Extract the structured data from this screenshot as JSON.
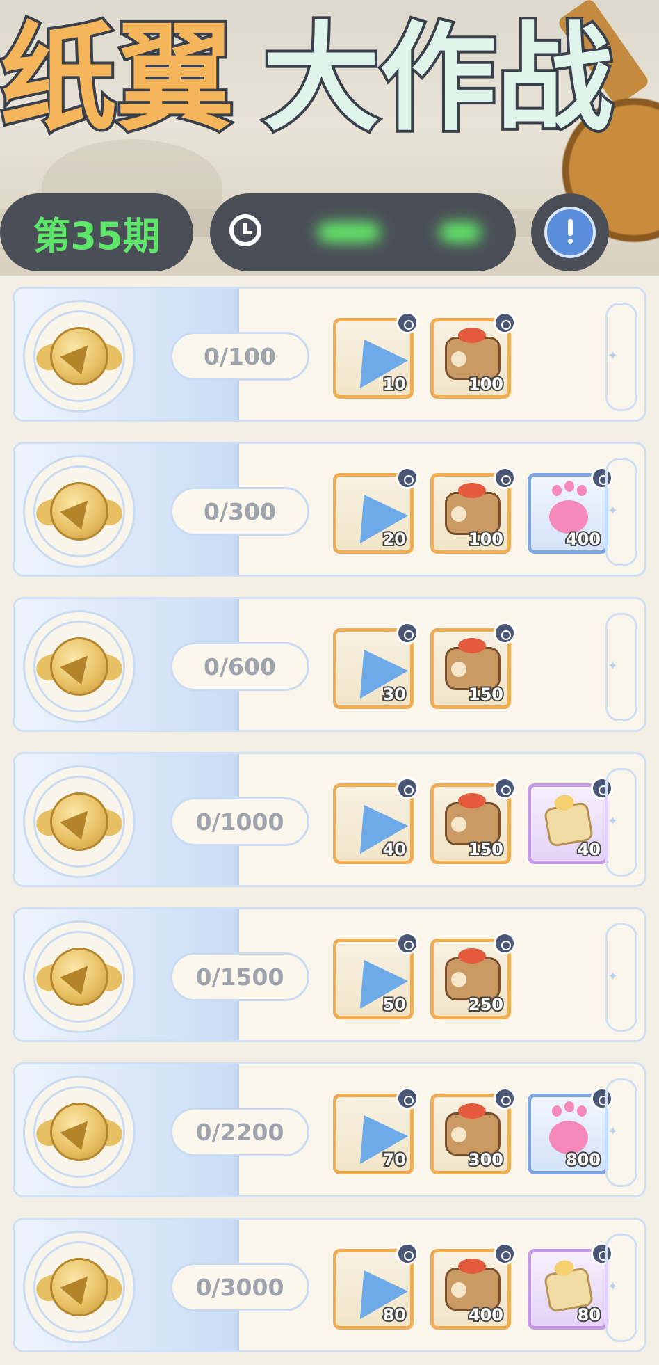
{
  "header": {
    "title_part1": "纸翼",
    "title_part2": "大作战",
    "issue_label": "第35期",
    "timer_text": "",
    "info_icon": "book-info-icon"
  },
  "colors": {
    "title_orange": "#f5b65b",
    "title_mint": "#dff4ea",
    "issue_green": "#5ee66a",
    "pill_dark": "#4a4f57",
    "row_bg": "#faf6ec",
    "accent_blue": "#c9dcf5",
    "reward_orange": "#f0ad54",
    "reward_blue": "#7fa6e4",
    "reward_purple": "#c79ae8"
  },
  "tiers": [
    {
      "progress": "0/100",
      "rewards": [
        {
          "item": "paper-plane-icon",
          "rarity": "orange",
          "count": "10"
        },
        {
          "item": "cake-roll-icon",
          "rarity": "orange",
          "count": "100"
        }
      ]
    },
    {
      "progress": "0/300",
      "rewards": [
        {
          "item": "paper-plane-icon",
          "rarity": "orange",
          "count": "20"
        },
        {
          "item": "cake-roll-icon",
          "rarity": "orange",
          "count": "100"
        },
        {
          "item": "paw-icon",
          "rarity": "blue",
          "count": "400"
        }
      ]
    },
    {
      "progress": "0/600",
      "rewards": [
        {
          "item": "paper-plane-icon",
          "rarity": "orange",
          "count": "30"
        },
        {
          "item": "cake-roll-icon",
          "rarity": "orange",
          "count": "150"
        }
      ]
    },
    {
      "progress": "0/1000",
      "rewards": [
        {
          "item": "paper-plane-icon",
          "rarity": "orange",
          "count": "40"
        },
        {
          "item": "cake-roll-icon",
          "rarity": "orange",
          "count": "150"
        },
        {
          "item": "candy-icon",
          "rarity": "purple",
          "count": "40"
        }
      ]
    },
    {
      "progress": "0/1500",
      "rewards": [
        {
          "item": "paper-plane-icon",
          "rarity": "orange",
          "count": "50"
        },
        {
          "item": "cake-roll-icon",
          "rarity": "orange",
          "count": "250"
        }
      ]
    },
    {
      "progress": "0/2200",
      "rewards": [
        {
          "item": "paper-plane-icon",
          "rarity": "orange",
          "count": "70"
        },
        {
          "item": "cake-roll-icon",
          "rarity": "orange",
          "count": "300"
        },
        {
          "item": "paw-icon",
          "rarity": "blue",
          "count": "800"
        }
      ]
    },
    {
      "progress": "0/3000",
      "rewards": [
        {
          "item": "paper-plane-icon",
          "rarity": "orange",
          "count": "80"
        },
        {
          "item": "cake-roll-icon",
          "rarity": "orange",
          "count": "400"
        },
        {
          "item": "candy-icon",
          "rarity": "purple",
          "count": "80"
        }
      ]
    }
  ]
}
